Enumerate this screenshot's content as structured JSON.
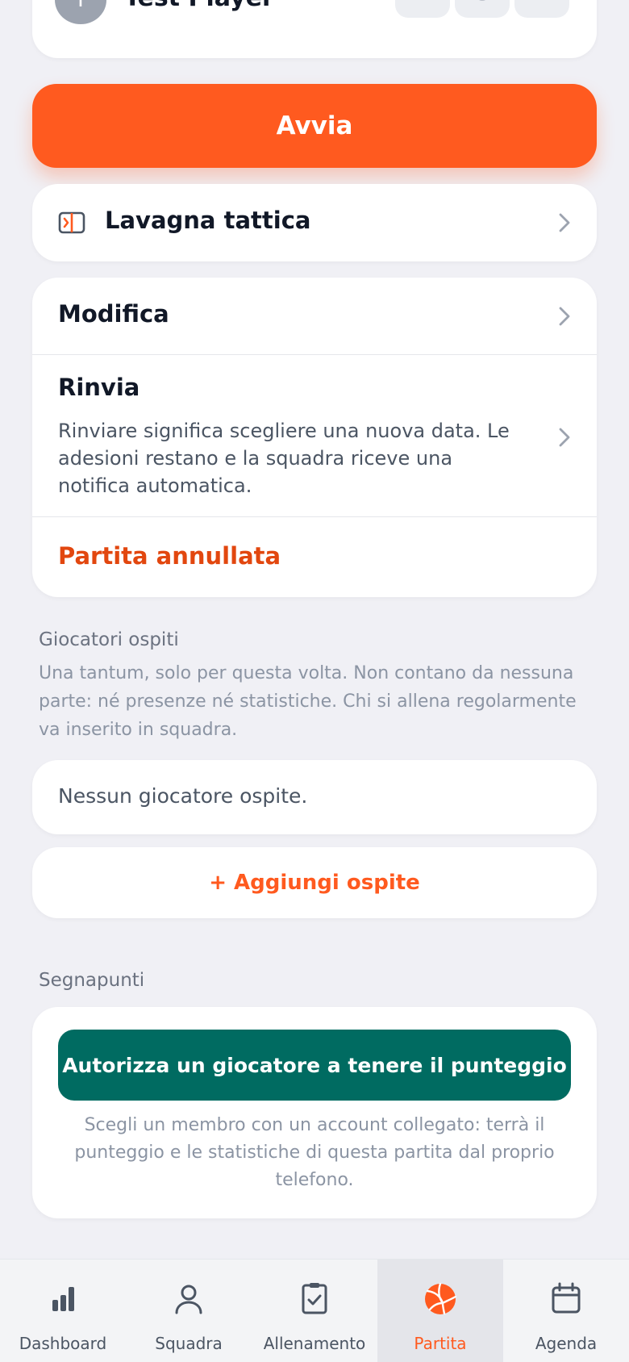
{
  "player": {
    "initial": "T",
    "name": "Test Player"
  },
  "primary_action": {
    "label": "Avvia"
  },
  "tactics": {
    "label": "Lavagna tattica"
  },
  "actions": {
    "edit": "Modifica",
    "postpone_title": "Rinvia",
    "postpone_desc": "Rinviare significa scegliere una nuova data. Le adesioni restano e la squadra riceve una notifica automatica.",
    "cancelled": "Partita annullata"
  },
  "guests": {
    "section_label": "Giocatori ospiti",
    "section_desc": "Una tantum, solo per questa volta. Non contano da nessuna parte: né presenze né statistiche. Chi si allena regolarmente va inserito in squadra.",
    "empty": "Nessun giocatore ospite.",
    "add": "+ Aggiungi ospite"
  },
  "scorekeeper": {
    "section_label": "Segnapunti",
    "button": "Autorizza un giocatore a tenere il punteggio",
    "note": "Scegli un membro con un account collegato: terrà il punteggio e le statistiche di questa partita dal proprio telefono."
  },
  "tabs": [
    {
      "label": "Dashboard",
      "icon": "bar-chart-icon"
    },
    {
      "label": "Squadra",
      "icon": "user-icon"
    },
    {
      "label": "Allenamento",
      "icon": "clipboard-check-icon"
    },
    {
      "label": "Partita",
      "icon": "volleyball-icon",
      "active": true
    },
    {
      "label": "Agenda",
      "icon": "calendar-icon"
    }
  ],
  "colors": {
    "accent": "#ff5a1f",
    "danger": "#e2470f",
    "teal": "#006b61",
    "background": "#f0f0f5"
  }
}
